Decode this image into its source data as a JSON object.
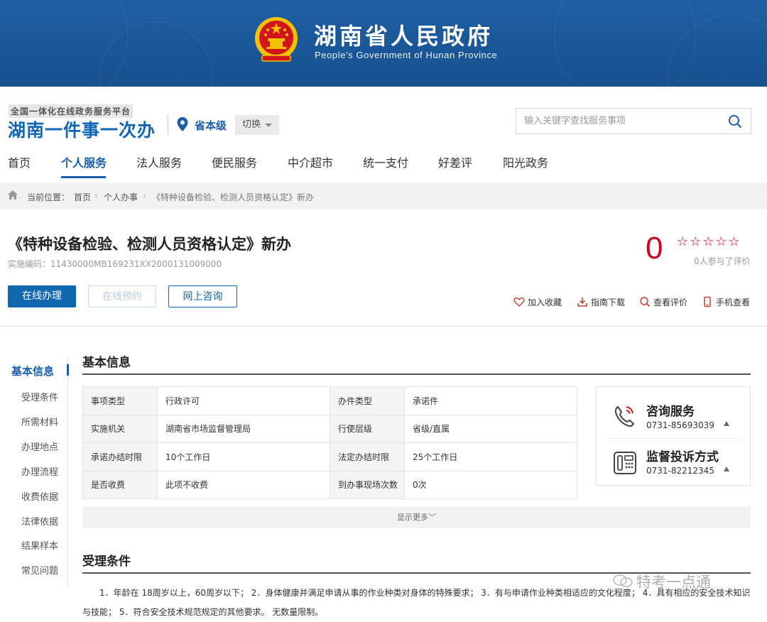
{
  "banner": {
    "title": "湖南省人民政府",
    "subtitle": "People's Government of Hunan Province"
  },
  "platform": {
    "small": "全国一体化在线政务服务平台",
    "big": "湖南一件事一次办",
    "level": "省本级",
    "switch_label": "切换"
  },
  "search": {
    "placeholder": "输入关键字查找服务事项"
  },
  "nav": {
    "items": [
      "首页",
      "个人服务",
      "法人服务",
      "便民服务",
      "中介超市",
      "统一支付",
      "好差评",
      "阳光政务"
    ],
    "active": "个人服务"
  },
  "breadcrumb": {
    "label": "当前位置：",
    "items": [
      "首页",
      "个人办事",
      "《特种设备检验、检测人员资格认定》新办"
    ]
  },
  "service": {
    "title": "《特种设备检验、检测人员资格认定》新办",
    "code": "实施编码：11430000MB169231XX2000131009000",
    "score": "0",
    "stars": "☆☆☆☆☆",
    "rate_count": "0人参与了评价"
  },
  "actions": {
    "online_apply": "在线办理",
    "online_booking": "在线预约",
    "online_consult": "网上咨询"
  },
  "tools": {
    "favorite": "加入收藏",
    "guide_download": "指南下载",
    "view_rating": "查看评价",
    "mobile_view": "手机查看"
  },
  "side_nav": [
    "基本信息",
    "受理条件",
    "所需材料",
    "办理地点",
    "办理流程",
    "收费依据",
    "法律依据",
    "结果样本",
    "常见问题"
  ],
  "basic_info": {
    "heading": "基本信息",
    "rows": [
      [
        "事项类型",
        "行政许可",
        "办件类型",
        "承诺件"
      ],
      [
        "实施机关",
        "湖南省市场监督管理局",
        "行使层级",
        "省级/直属"
      ],
      [
        "承诺办结时限",
        "10个工作日",
        "法定办结时限",
        "25个工作日"
      ],
      [
        "是否收费",
        "此项不收费",
        "到办事现场次数",
        "0次"
      ]
    ],
    "more": "显示更多"
  },
  "contact": {
    "consult_title": "咨询服务",
    "consult_phone": "0731-85693039",
    "complaint_title": "监督投诉方式",
    "complaint_phone": "0731-82212345"
  },
  "conditions": {
    "heading": "受理条件",
    "text": "1．年龄在 18周岁以上，60周岁以下； 2．身体健康并满足申请从事的作业种类对身体的特殊要求； 3．有与申请作业种类相适应的文化程度； 4．具有相应的安全技术知识与技能； 5．符合安全技术规范规定的其他要求。 无数量限制。"
  },
  "watermark": "特考一点通",
  "colors": {
    "brand_blue": "#1a5ea8",
    "banner_blue": "#1f5fa3",
    "score_red": "#d0021b"
  }
}
